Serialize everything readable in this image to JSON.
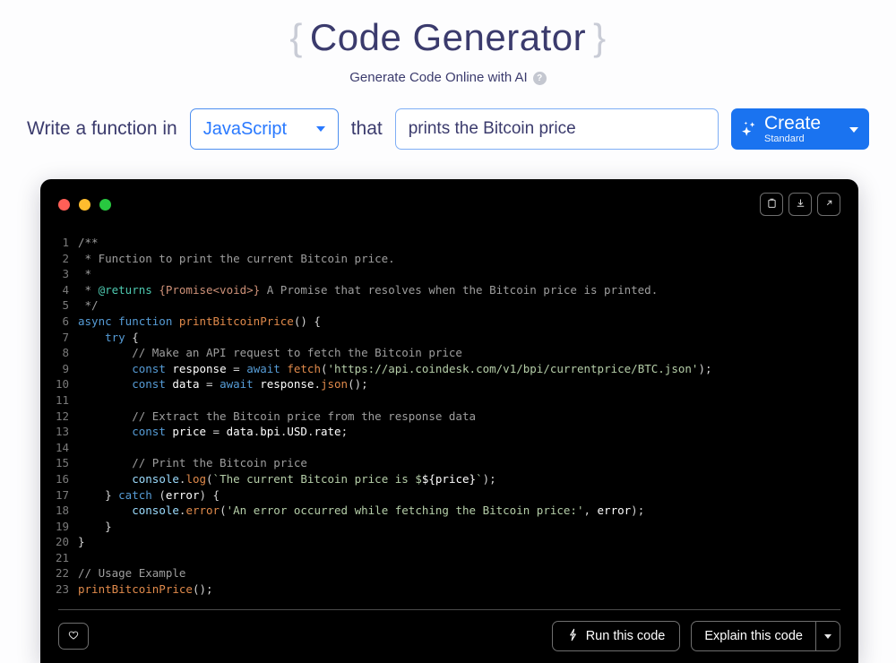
{
  "header": {
    "brace_left": "{",
    "title": "Code Generator",
    "brace_right": "}",
    "subtitle": "Generate Code Online with AI",
    "help_icon_glyph": "?"
  },
  "form": {
    "label_prefix": "Write a function in",
    "language_value": "JavaScript",
    "label_middle": "that",
    "prompt_value": "prints the Bitcoin price",
    "prompt_placeholder": "prints the Bitcoin price",
    "create_label": "Create",
    "create_sublabel": "Standard"
  },
  "panel": {
    "window_dots": [
      "red",
      "yellow",
      "green"
    ],
    "actions": [
      {
        "name": "copy-icon",
        "title": "Copy"
      },
      {
        "name": "download-icon",
        "title": "Download"
      },
      {
        "name": "open-external-icon",
        "title": "Open"
      }
    ],
    "accent_blue": "#1a73f0",
    "panel_bg": "#000000",
    "title_color": "#3b3b6d"
  },
  "code": {
    "language": "javascript",
    "line_count": 23,
    "lines": [
      {
        "n": "1",
        "text": "/**"
      },
      {
        "n": "2",
        "text": " * Function to print the current Bitcoin price."
      },
      {
        "n": "3",
        "text": " *"
      },
      {
        "n": "4",
        "text": " * @returns {Promise<void>} A Promise that resolves when the Bitcoin price is printed."
      },
      {
        "n": "5",
        "text": " */"
      },
      {
        "n": "6",
        "text": "async function printBitcoinPrice() {"
      },
      {
        "n": "7",
        "text": "    try {"
      },
      {
        "n": "8",
        "text": "        // Make an API request to fetch the Bitcoin price"
      },
      {
        "n": "9",
        "text": "        const response = await fetch('https://api.coindesk.com/v1/bpi/currentprice/BTC.json');"
      },
      {
        "n": "10",
        "text": "        const data = await response.json();"
      },
      {
        "n": "11",
        "text": ""
      },
      {
        "n": "12",
        "text": "        // Extract the Bitcoin price from the response data"
      },
      {
        "n": "13",
        "text": "        const price = data.bpi.USD.rate;"
      },
      {
        "n": "14",
        "text": ""
      },
      {
        "n": "15",
        "text": "        // Print the Bitcoin price"
      },
      {
        "n": "16",
        "text": "        console.log(`The current Bitcoin price is $${price}`);"
      },
      {
        "n": "17",
        "text": "    } catch (error) {"
      },
      {
        "n": "18",
        "text": "        console.error('An error occurred while fetching the Bitcoin price:', error);"
      },
      {
        "n": "19",
        "text": "    }"
      },
      {
        "n": "20",
        "text": "}"
      },
      {
        "n": "21",
        "text": ""
      },
      {
        "n": "22",
        "text": "// Usage Example"
      },
      {
        "n": "23",
        "text": "printBitcoinPrice();"
      }
    ]
  },
  "footer": {
    "favorite_label": "",
    "run_label": "Run this code",
    "explain_label": "Explain this code"
  }
}
